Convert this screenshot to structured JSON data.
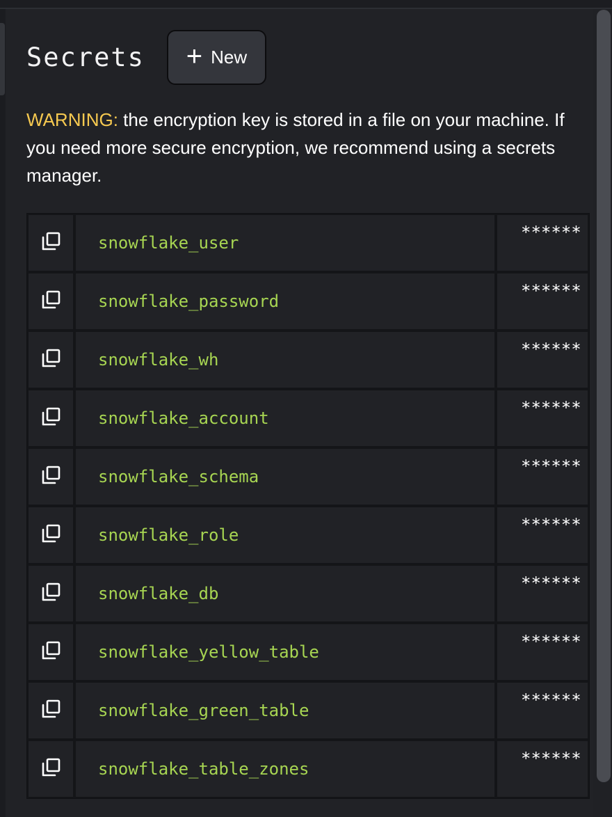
{
  "header": {
    "title": "Secrets",
    "new_button_label": "New"
  },
  "warning": {
    "label": "WARNING:",
    "text": " the encryption key is stored in a file on your machine. If you need more secure encryption, we recommend using a secrets manager."
  },
  "secrets": [
    {
      "name": "snowflake_user",
      "value": "******"
    },
    {
      "name": "snowflake_password",
      "value": "******"
    },
    {
      "name": "snowflake_wh",
      "value": "******"
    },
    {
      "name": "snowflake_account",
      "value": "******"
    },
    {
      "name": "snowflake_schema",
      "value": "******"
    },
    {
      "name": "snowflake_role",
      "value": "******"
    },
    {
      "name": "snowflake_db",
      "value": "******"
    },
    {
      "name": "snowflake_yellow_table",
      "value": "******"
    },
    {
      "name": "snowflake_green_table",
      "value": "******"
    },
    {
      "name": "snowflake_table_zones",
      "value": "******"
    }
  ],
  "colors": {
    "background": "#212226",
    "secret_name": "#a7d552",
    "warning_label": "#f6c950"
  },
  "icons": {
    "copy": "copy-icon",
    "plus": "plus-icon"
  }
}
